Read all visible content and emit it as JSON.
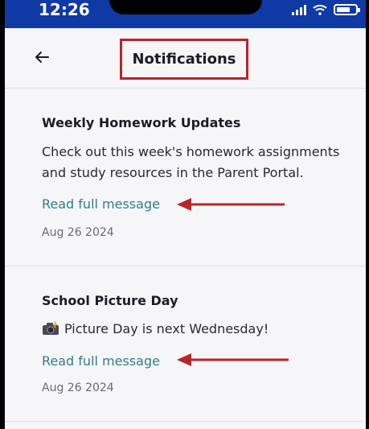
{
  "status": {
    "time": "12:26"
  },
  "header": {
    "title": "Notifications",
    "back_icon": "arrow-left-icon"
  },
  "notifications": [
    {
      "title": "Weekly Homework Updates",
      "body": "Check out this week's homework assignments and study resources in the Parent Portal.",
      "link": "Read full message",
      "date": "Aug 26 2024"
    },
    {
      "title": "School Picture Day",
      "body": "Picture Day is next Wednesday!",
      "body_icon": "camera-flash-icon",
      "link": "Read full message",
      "date": "Aug 26 2024"
    }
  ],
  "colors": {
    "status_bar": "#0f3aa6",
    "highlight": "#b5262c",
    "link": "#2f7f8c"
  }
}
